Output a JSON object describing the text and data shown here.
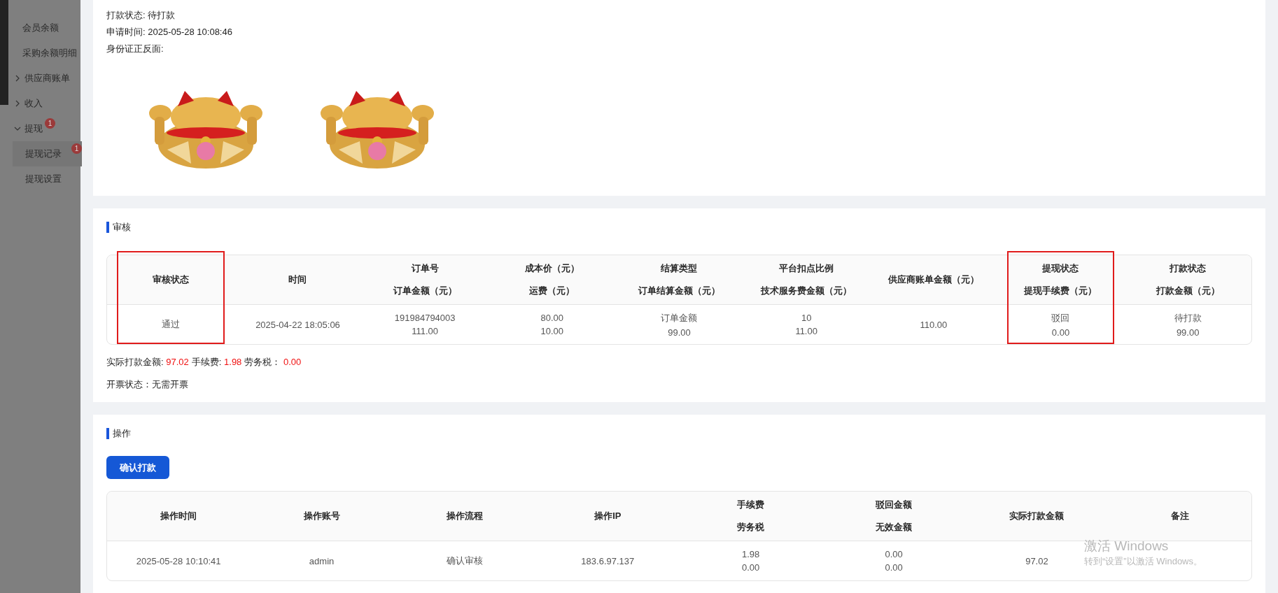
{
  "sidebar": {
    "items": [
      {
        "label": "会员余额",
        "kind": "leaf",
        "selected": false
      },
      {
        "label": "采购余额明细",
        "kind": "leaf",
        "selected": false
      },
      {
        "label": "供应商账单",
        "kind": "group",
        "expanded": false
      },
      {
        "label": "收入",
        "kind": "group",
        "expanded": false
      },
      {
        "label": "提现",
        "kind": "group",
        "expanded": true,
        "badge": "1",
        "children": [
          {
            "label": "提现记录",
            "kind": "leaf",
            "selected": true,
            "badge": "1"
          },
          {
            "label": "提现设置",
            "kind": "leaf",
            "selected": false
          }
        ]
      }
    ]
  },
  "info": {
    "lines": [
      "打款状态: 待打款",
      "申请时间: 2025-05-28 10:08:46",
      "身份证正反面:"
    ]
  },
  "audit": {
    "title": "审核",
    "columns": [
      {
        "lines": [
          "审核状态"
        ],
        "highlighted": true
      },
      {
        "lines": [
          "时间"
        ],
        "highlighted": false
      },
      {
        "lines": [
          "订单号",
          "订单金额（元）"
        ],
        "highlighted": false
      },
      {
        "lines": [
          "成本价（元）",
          "运费（元）"
        ],
        "highlighted": false
      },
      {
        "lines": [
          "结算类型",
          "订单结算金额（元）"
        ],
        "highlighted": false
      },
      {
        "lines": [
          "平台扣点比例",
          "技术服务费金额（元）"
        ],
        "highlighted": false
      },
      {
        "lines": [
          "供应商账单金额（元）"
        ],
        "highlighted": false
      },
      {
        "lines": [
          "提现状态",
          "提现手续费（元）"
        ],
        "highlighted": true
      },
      {
        "lines": [
          "打款状态",
          "打款金额（元）"
        ],
        "highlighted": false
      }
    ],
    "rows": [
      {
        "cells": [
          [
            "通过"
          ],
          [
            "2025-04-22 18:05:06"
          ],
          [
            "191984794003",
            "111.00"
          ],
          [
            "80.00",
            "10.00"
          ],
          [
            "订单金额",
            "99.00"
          ],
          [
            "10",
            "11.00"
          ],
          [
            "110.00"
          ],
          [
            "驳回",
            "0.00"
          ],
          [
            "待打款",
            "99.00"
          ]
        ]
      }
    ],
    "summary": [
      {
        "label": "实际打款金额:",
        "value": "97.02"
      },
      {
        "label": "手续费:",
        "value": "1.98"
      },
      {
        "label": "劳务税：",
        "value": "0.00"
      }
    ],
    "invoice": "开票状态：无需开票"
  },
  "operations": {
    "title": "操作",
    "button": "确认打款",
    "columns": [
      {
        "lines": [
          "操作时间"
        ]
      },
      {
        "lines": [
          "操作账号"
        ]
      },
      {
        "lines": [
          "操作流程"
        ]
      },
      {
        "lines": [
          "操作IP"
        ]
      },
      {
        "lines": [
          "手续费",
          "劳务税"
        ]
      },
      {
        "lines": [
          "驳回金额",
          "无效金额"
        ]
      },
      {
        "lines": [
          "实际打款金额"
        ]
      },
      {
        "lines": [
          "备注"
        ]
      }
    ],
    "rows": [
      {
        "cells": [
          [
            "2025-05-28 10:10:41"
          ],
          [
            "admin"
          ],
          [
            "确认审核"
          ],
          [
            "183.6.97.137"
          ],
          [
            "1.98",
            "0.00"
          ],
          [
            "0.00",
            "0.00"
          ],
          [
            "97.02"
          ],
          []
        ]
      }
    ]
  },
  "os_notice": {
    "title": "激活 Windows",
    "text": "转到“设置”以激活 Windows。"
  }
}
